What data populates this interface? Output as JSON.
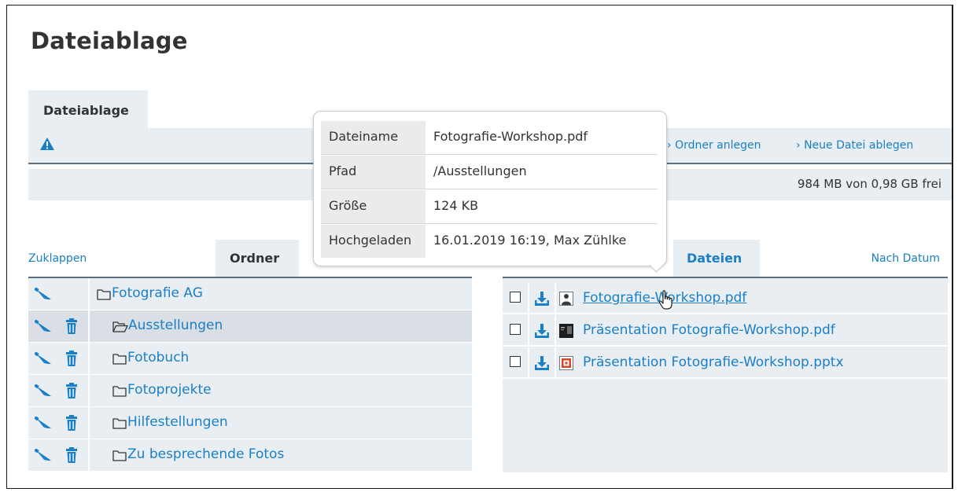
{
  "page": {
    "title": "Dateiablage"
  },
  "tabs": {
    "main": "Dateiablage",
    "folders": "Ordner",
    "files": "Dateien"
  },
  "actions": {
    "create_folder": "Ordner anlegen",
    "upload_file": "Neue Datei ablegen",
    "collapse": "Zuklappen",
    "sort": "Nach Datum"
  },
  "storage": {
    "text": "984 MB von 0,98 GB frei"
  },
  "folders": [
    {
      "name": "Fotografie AG",
      "level": 0,
      "open": false,
      "deletable": false,
      "selected": false
    },
    {
      "name": "Ausstellungen",
      "level": 1,
      "open": true,
      "deletable": true,
      "selected": true
    },
    {
      "name": "Fotobuch",
      "level": 1,
      "open": false,
      "deletable": true,
      "selected": false
    },
    {
      "name": "Fotoprojekte",
      "level": 1,
      "open": false,
      "deletable": true,
      "selected": false
    },
    {
      "name": "Hilfestellungen",
      "level": 1,
      "open": false,
      "deletable": true,
      "selected": false
    },
    {
      "name": "Zu besprechende Fotos",
      "level": 1,
      "open": false,
      "deletable": true,
      "selected": false
    }
  ],
  "files": [
    {
      "name": "Fotografie-Workshop.pdf",
      "thumb": "portrait-thumbnail",
      "hovered": true
    },
    {
      "name": "Präsentation Fotografie-Workshop.pdf",
      "thumb": "dark-slide-thumbnail",
      "hovered": false
    },
    {
      "name": "Präsentation Fotografie-Workshop.pptx",
      "thumb": "powerpoint-icon",
      "hovered": false
    }
  ],
  "tooltip": {
    "rows": [
      {
        "key": "Dateiname",
        "value": "Fotografie-Workshop.pdf"
      },
      {
        "key": "Pfad",
        "value": "/Ausstellungen"
      },
      {
        "key": "Größe",
        "value": "124 KB"
      },
      {
        "key": "Hochgeladen",
        "value": "16.01.2019 16:19, Max Zühlke"
      }
    ]
  },
  "colors": {
    "accent": "#1a7fc6",
    "panel": "#e9eef3",
    "selected": "#d9dfe5",
    "rule": "#5a6e80"
  }
}
